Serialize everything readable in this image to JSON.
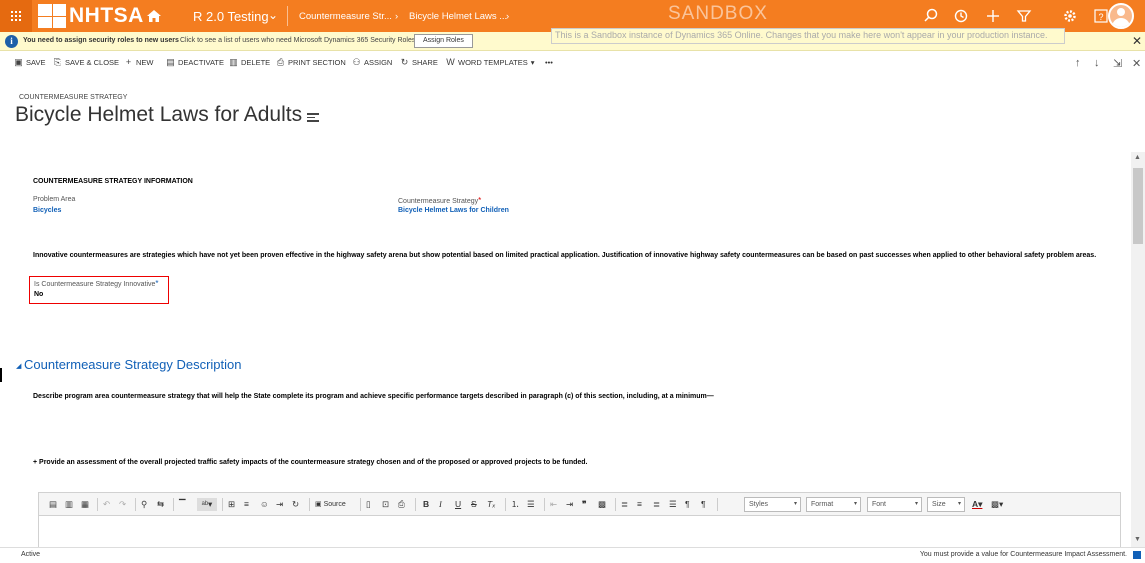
{
  "topbar": {
    "logo_text": "NHTSA",
    "app_name": "R 2.0 Testing",
    "app_chevron": "⌄",
    "breadcrumb_1": "Countermeasure Str...",
    "breadcrumb_2": "Bicycle Helmet Laws ...",
    "breadcrumb_sep": "›",
    "sandbox_label": "SANDBOX",
    "bg_color": "#f47d20",
    "icons": [
      "search-icon",
      "history-icon",
      "plus-icon",
      "filter-icon",
      "gear-icon",
      "help-icon",
      "user-avatar"
    ]
  },
  "notification": {
    "bold_text": "You need to assign security roles to new users",
    "text": "Click to see a list of users who need Microsoft Dynamics 365 Security Roles.",
    "button_label": "Assign Roles",
    "sandbox_message": "This is a Sandbox instance of Dynamics 365 Online. Changes that you make here won't appear in your production instance."
  },
  "commandbar": {
    "save": "Save",
    "save_close": "Save & Close",
    "new": "New",
    "deactivate": "Deactivate",
    "delete": "Delete",
    "print_section": "Print Section",
    "assign": "Assign",
    "share": "Share",
    "word_templates": "Word Templates",
    "more": "•••"
  },
  "header": {
    "entity_label": "COUNTERMEASURE STRATEGY",
    "title": "Bicycle Helmet Laws for Adults"
  },
  "form": {
    "section_info_title": "COUNTERMEASURE STRATEGY INFORMATION",
    "problem_area_label": "Problem Area",
    "problem_area_value": "Bicycles",
    "strategy_label": "Countermeasure Strategy",
    "strategy_value": "Bicycle Helmet Laws for Children",
    "innovative_paragraph": "Innovative countermeasures are strategies which have not yet been proven effective in the highway safety arena but show potential based on limited practical application. Justification of innovative highway safety countermeasures can be based on past successes when applied to other behavioral safety problem areas.",
    "innovative_label": "Is Countermeasure Strategy Innovative",
    "innovative_value": "No",
    "description_section_title": "Countermeasure Strategy Description",
    "describe_paragraph": "Describe program area countermeasure strategy that will help the State complete its program and achieve specific performance targets described in paragraph (c) of this section, including, at a minimum—",
    "assessment_paragraph": "+ Provide an assessment of the overall projected traffic safety impacts of the countermeasure strategy chosen and of the proposed or approved projects to be funded."
  },
  "editor": {
    "source_label": "Source",
    "styles_label": "Styles",
    "format_label": "Format",
    "font_label": "Font",
    "size_label": "Size"
  },
  "status": {
    "state": "Active",
    "message": "You must provide a value for Countermeasure Impact Assessment."
  }
}
